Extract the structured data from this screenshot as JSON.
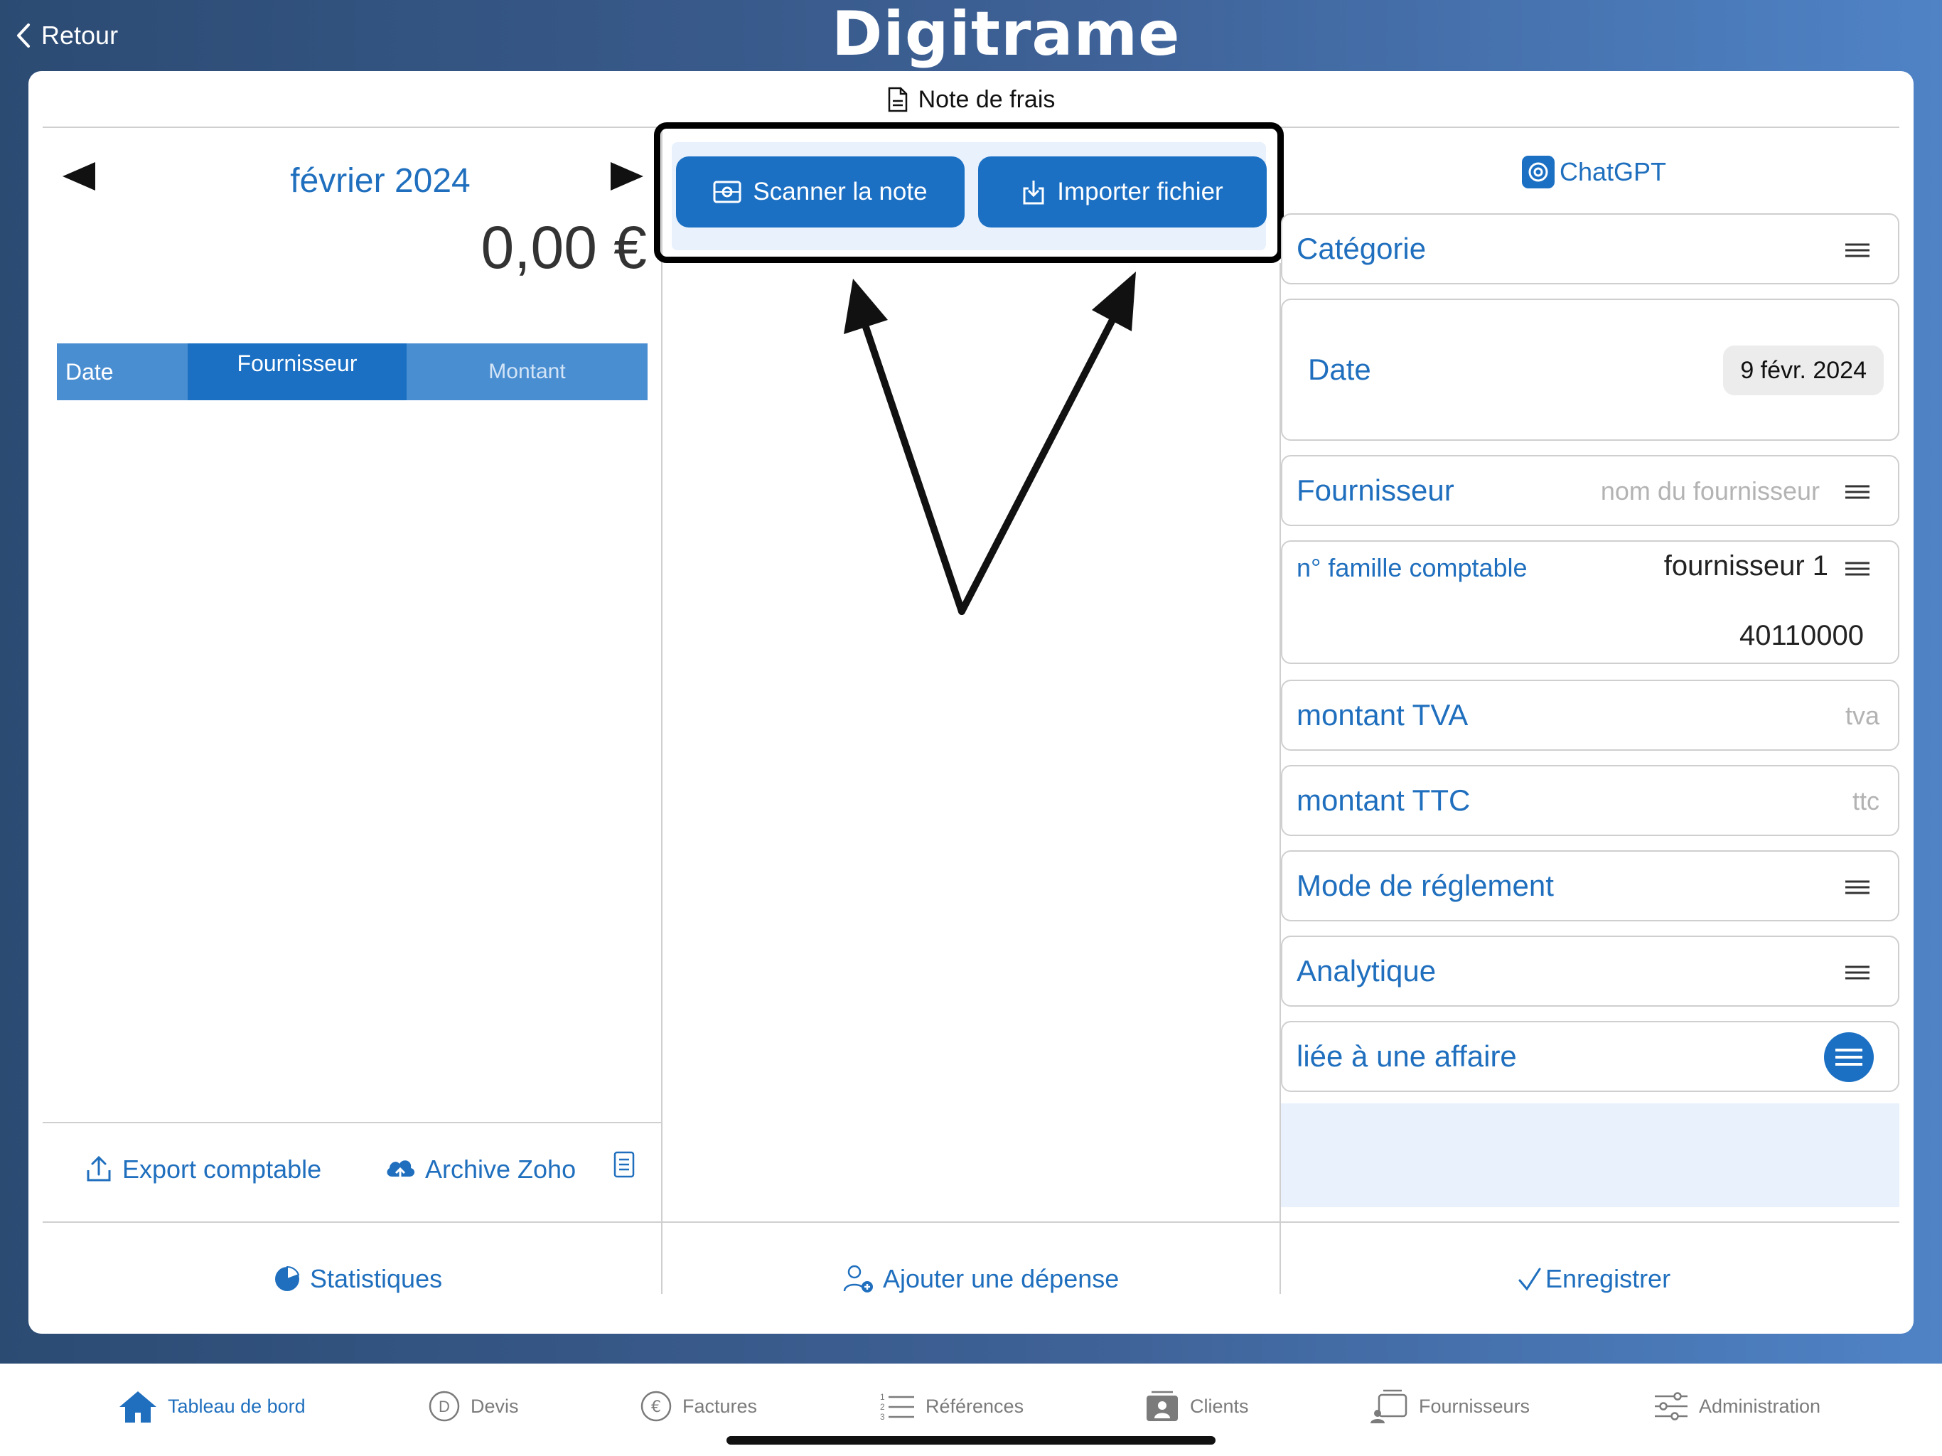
{
  "app": {
    "logo": "Digitrame",
    "back_label": "Retour"
  },
  "panel": {
    "title": "Note de frais"
  },
  "left": {
    "month": "février 2024",
    "total": "0,00 €",
    "table": {
      "columns": [
        "Date",
        "Fournisseur",
        "Montant"
      ]
    },
    "footer": {
      "export": "Export comptable",
      "archive": "Archive Zoho"
    }
  },
  "middle": {
    "scan_label": "Scanner la note",
    "import_label": "Importer fichier"
  },
  "right": {
    "chatgpt": "ChatGPT",
    "categorie": "Catégorie",
    "date_label": "Date",
    "date_value": "9 févr. 2024",
    "fournisseur_label": "Fournisseur",
    "fournisseur_placeholder": "nom du fournisseur",
    "famille_label": "n° famille comptable",
    "famille_value": "fournisseur 1",
    "famille_code": "40110000",
    "tva_label": "montant TVA",
    "tva_placeholder": "tva",
    "ttc_label": "montant TTC",
    "ttc_placeholder": "ttc",
    "reglement_label": "Mode de réglement",
    "analytique_label": "Analytique",
    "affaire_label": "liée à une affaire"
  },
  "actions": {
    "stats": "Statistiques",
    "add": "Ajouter une dépense",
    "save": "Enregistrer"
  },
  "tabs": [
    {
      "label": "Tableau de bord",
      "icon": "home-icon"
    },
    {
      "label": "Devis",
      "icon": "devis-icon"
    },
    {
      "label": "Factures",
      "icon": "euro-icon"
    },
    {
      "label": "Références",
      "icon": "list-icon"
    },
    {
      "label": "Clients",
      "icon": "clients-icon"
    },
    {
      "label": "Fournisseurs",
      "icon": "suppliers-icon"
    },
    {
      "label": "Administration",
      "icon": "sliders-icon"
    }
  ],
  "colors": {
    "accent": "#1b70c4",
    "label_blue": "#1f6fbe",
    "header_gradient_start": "#2c4b73",
    "header_gradient_end": "#4f83c6"
  }
}
